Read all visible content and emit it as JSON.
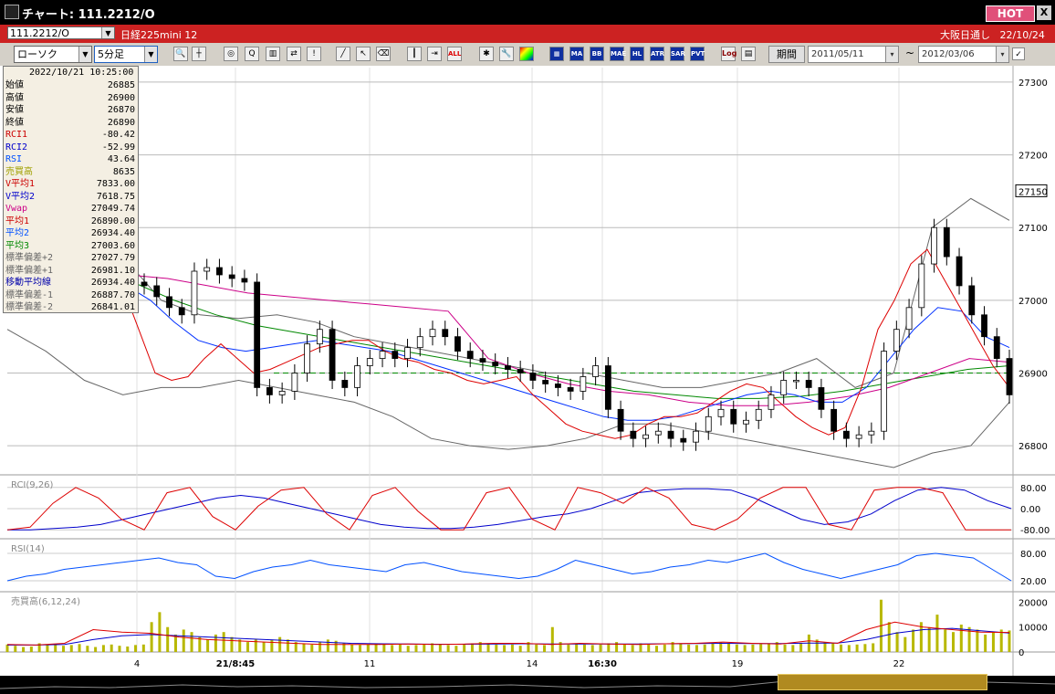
{
  "window": {
    "title": "チャート: 111.2212/O",
    "hot_label": "HOT",
    "close_label": "X"
  },
  "info_bar": {
    "symbol": "111.2212/O",
    "instrument_name": "日経225mini 12",
    "market": "大阪日通し",
    "date": "22/10/24"
  },
  "toolbar": {
    "chart_type": "ローソク",
    "period": "5分足",
    "period_button": "期間",
    "date_from": "2011/05/11",
    "date_to": "2012/03/06",
    "tilde": "~",
    "icon_labels": [
      "MA",
      "BB",
      "MAE",
      "HL",
      "ATR",
      "SAR",
      "PVT",
      "Log",
      "ALL"
    ]
  },
  "data_panel": {
    "timestamp": "2022/10/21  10:25:00",
    "rows": [
      {
        "label": "始値",
        "value": "26885",
        "color": "#000000"
      },
      {
        "label": "高値",
        "value": "26900",
        "color": "#000000"
      },
      {
        "label": "安値",
        "value": "26870",
        "color": "#000000"
      },
      {
        "label": "終値",
        "value": "26890",
        "color": "#000000"
      },
      {
        "label": "RCI1",
        "value": "-80.42",
        "color": "#cc0000"
      },
      {
        "label": "RCI2",
        "value": "-52.99",
        "color": "#0000cc"
      },
      {
        "label": "RSI",
        "value": "43.64",
        "color": "#0050ff"
      },
      {
        "label": "売買高",
        "value": "8635",
        "color": "#a0a000"
      },
      {
        "label": "V平均1",
        "value": "7833.00",
        "color": "#cc0000"
      },
      {
        "label": "V平均2",
        "value": "7618.75",
        "color": "#0000cc"
      },
      {
        "label": "Vwap",
        "value": "27049.74",
        "color": "#cc0088"
      },
      {
        "label": "平均1",
        "value": "26890.00",
        "color": "#cc0000"
      },
      {
        "label": "平均2",
        "value": "26934.40",
        "color": "#0050ff"
      },
      {
        "label": "平均3",
        "value": "27003.60",
        "color": "#008800"
      },
      {
        "label": "標準偏差+2",
        "value": "27027.79",
        "color": "#666666"
      },
      {
        "label": "標準偏差+1",
        "value": "26981.10",
        "color": "#666666"
      },
      {
        "label": "移動平均線",
        "value": "26934.40",
        "color": "#0000aa"
      },
      {
        "label": "標準偏差-1",
        "value": "26887.70",
        "color": "#666666"
      },
      {
        "label": "標準偏差-2",
        "value": "26841.01",
        "color": "#666666"
      }
    ]
  },
  "chart_data": [
    {
      "type": "candlestick",
      "price_ticks": [
        "27300",
        "27200",
        "27150",
        "27100",
        "27000",
        "26900",
        "26800"
      ],
      "price_tick_values": [
        27300,
        27200,
        27100,
        27000,
        26900,
        26800
      ],
      "current_price": "27150",
      "ylim": [
        26760,
        27320
      ],
      "x_tick_labels": [
        "4",
        "21/8:45",
        "11",
        "14",
        "16:30",
        "19",
        "22"
      ],
      "closes": [
        27020,
        27005,
        26990,
        26980,
        27040,
        27045,
        27035,
        27030,
        27025,
        26880,
        26870,
        26875,
        26900,
        26940,
        26960,
        26890,
        26880,
        26910,
        26920,
        26930,
        26920,
        26935,
        26950,
        26960,
        26950,
        26930,
        26920,
        26915,
        26910,
        26905,
        26900,
        26890,
        26885,
        26880,
        26875,
        26895,
        26910,
        26850,
        26820,
        26810,
        26815,
        26820,
        26810,
        26805,
        26820,
        26840,
        26850,
        26830,
        26835,
        26850,
        26870,
        26890,
        26890,
        26880,
        26850,
        26820,
        26810,
        26815,
        26820,
        26930,
        26960,
        26990,
        27050,
        27100,
        27060,
        27020,
        26980,
        26950,
        26920,
        26870
      ],
      "ma1": [
        27020,
        27000,
        26995,
        27010,
        27030,
        27035,
        27030,
        27020,
        26960,
        26900,
        26890,
        26895,
        26920,
        26940,
        26920,
        26900,
        26905,
        26915,
        26925,
        26935,
        26940,
        26945,
        26945,
        26930,
        26920,
        26915,
        26905,
        26900,
        26890,
        26885,
        26890,
        26895,
        26870,
        26850,
        26830,
        26820,
        26815,
        26810,
        26815,
        26830,
        26840,
        26840,
        26845,
        26860,
        26875,
        26885,
        26880,
        26860,
        26840,
        26825,
        26815,
        26825,
        26880,
        26960,
        27000,
        27050,
        27070,
        27030,
        26990,
        26950,
        26910,
        26880
      ],
      "ma2": [
        27030,
        27020,
        27010,
        27020,
        27025,
        27020,
        27000,
        26970,
        26945,
        26935,
        26930,
        26935,
        26940,
        26945,
        26940,
        26935,
        26930,
        26920,
        26910,
        26900,
        26890,
        26880,
        26870,
        26860,
        26850,
        26840,
        26835,
        26835,
        26840,
        26850,
        26860,
        26870,
        26875,
        26870,
        26860,
        26860,
        26880,
        26920,
        26960,
        26990,
        26985,
        26950,
        26935
      ],
      "ma3": [
        27070,
        27060,
        27045,
        27025,
        27000,
        26980,
        26965,
        26955,
        26945,
        26935,
        26925,
        26915,
        26905,
        26895,
        26885,
        26875,
        26870,
        26865,
        26865,
        26868,
        26875,
        26885,
        26895,
        26905,
        26910
      ],
      "vwap": [
        27050,
        27045,
        27040,
        27035,
        27030,
        27020,
        27010,
        27005,
        27000,
        26995,
        26990,
        26985,
        26920,
        26900,
        26885,
        26875,
        26870,
        26860,
        26855,
        26855,
        26860,
        26868,
        26880,
        26900,
        26920,
        26915
      ],
      "bb_upper": [
        27080,
        27090,
        27100,
        27060,
        27000,
        26980,
        26975,
        26980,
        26970,
        26950,
        26940,
        26930,
        26920,
        26910,
        26900,
        26900,
        26890,
        26880,
        26880,
        26890,
        26900,
        26920,
        26880,
        26900,
        27100,
        27140,
        27110
      ],
      "bb_lower": [
        26960,
        26930,
        26890,
        26870,
        26880,
        26880,
        26890,
        26880,
        26870,
        26860,
        26840,
        26810,
        26800,
        26795,
        26800,
        26810,
        26830,
        26830,
        26820,
        26810,
        26800,
        26790,
        26780,
        26770,
        26790,
        26800,
        26860
      ]
    },
    {
      "type": "line",
      "title": "RCI(9,26)",
      "y_tick_labels": [
        "80.00",
        "0.00",
        "-80.00"
      ],
      "ylim": [
        -100,
        100
      ],
      "series": [
        {
          "name": "RCI1",
          "values": [
            -80,
            -70,
            20,
            80,
            40,
            -40,
            -80,
            60,
            80,
            -30,
            -80,
            10,
            70,
            80,
            -20,
            -80,
            50,
            80,
            -10,
            -80,
            -80,
            60,
            80,
            -40,
            -80,
            80,
            60,
            20,
            80,
            40,
            -60,
            -80,
            -40,
            40,
            80,
            80,
            -60,
            -80,
            70,
            80,
            80,
            60,
            -80,
            -80,
            -80
          ]
        },
        {
          "name": "RCI2",
          "values": [
            -80,
            -80,
            -75,
            -70,
            -60,
            -40,
            -20,
            0,
            20,
            40,
            50,
            40,
            20,
            0,
            -20,
            -40,
            -60,
            -70,
            -75,
            -75,
            -70,
            -60,
            -45,
            -30,
            -20,
            0,
            30,
            60,
            70,
            75,
            75,
            70,
            40,
            0,
            -40,
            -60,
            -50,
            -20,
            30,
            70,
            80,
            70,
            30,
            0
          ]
        }
      ]
    },
    {
      "type": "line",
      "title": "RSI(14)",
      "y_tick_labels": [
        "80.00",
        "20.00"
      ],
      "ylim": [
        0,
        100
      ],
      "series": [
        {
          "name": "RSI",
          "values": [
            20,
            30,
            35,
            45,
            50,
            55,
            60,
            65,
            70,
            60,
            55,
            30,
            25,
            40,
            50,
            55,
            65,
            55,
            50,
            45,
            40,
            55,
            60,
            50,
            40,
            35,
            30,
            25,
            30,
            45,
            65,
            55,
            45,
            35,
            40,
            50,
            55,
            65,
            60,
            70,
            80,
            60,
            45,
            35,
            25,
            35,
            45,
            55,
            75,
            80,
            75,
            70,
            45,
            20
          ]
        }
      ]
    },
    {
      "type": "bar",
      "title": "売買高(6,12,24)",
      "y_tick_labels": [
        "20000",
        "10000",
        "0"
      ],
      "ylim": [
        0,
        22000
      ],
      "values": [
        3000,
        2500,
        2000,
        2200,
        3500,
        2800,
        3000,
        2500,
        2800,
        3200,
        2500,
        2000,
        2800,
        3000,
        2500,
        2200,
        2800,
        3000,
        12000,
        16000,
        10000,
        7000,
        9000,
        8000,
        6000,
        5000,
        7000,
        8000,
        6000,
        5000,
        4000,
        5000,
        4000,
        5000,
        6000,
        5000,
        4000,
        3500,
        3000,
        4000,
        5000,
        4500,
        3500,
        3000,
        2800,
        3000,
        3500,
        3000,
        2800,
        3000,
        2500,
        2800,
        3000,
        3500,
        3000,
        2800,
        2500,
        3000,
        3500,
        4000,
        3500,
        3000,
        2800,
        3000,
        2500,
        4000,
        3000,
        2800,
        10000,
        4000,
        3000,
        3500,
        3000,
        2800,
        3000,
        3500,
        4000,
        3000,
        2800,
        3500,
        3000,
        2500,
        3000,
        4000,
        3500,
        3000,
        2800,
        3000,
        3500,
        4000,
        3500,
        3000,
        2800,
        3000,
        3200,
        3500,
        4000,
        3000,
        2800,
        3500,
        7000,
        5000,
        4000,
        3500,
        3000,
        2800,
        3000,
        3200,
        3500,
        21000,
        12000,
        8000,
        6000,
        9000,
        12000,
        10000,
        15000,
        9000,
        8000,
        11000,
        10000,
        9000,
        7000,
        8000,
        9000,
        8635
      ],
      "ma_series": [
        {
          "name": "V平均1",
          "values": [
            3000,
            2800,
            3500,
            9000,
            8000,
            7500,
            6000,
            5000,
            4500,
            4000,
            3500,
            3000,
            3000,
            3000,
            3200,
            3000,
            3200,
            3500,
            3500,
            3000,
            3500,
            3200,
            3000,
            3300,
            3500,
            4000,
            3500,
            3200,
            4500,
            3500,
            9000,
            12000,
            10000,
            9000,
            8000,
            7833
          ]
        },
        {
          "name": "V平均2",
          "values": [
            2800,
            2800,
            3000,
            5000,
            6500,
            7000,
            6500,
            6000,
            5500,
            5000,
            4500,
            4000,
            3500,
            3300,
            3200,
            3100,
            3100,
            3200,
            3300,
            3200,
            3200,
            3200,
            3200,
            3300,
            3400,
            3500,
            3400,
            3400,
            3600,
            3600,
            5000,
            7500,
            9000,
            9500,
            8500,
            7619
          ]
        }
      ]
    }
  ],
  "colors": {
    "candle_up": "#ffffff",
    "candle_down": "#000000",
    "ma1": "#dd0000",
    "ma2": "#0030ff",
    "ma3": "#008800",
    "vwap": "#cc0088",
    "bb": "#666666",
    "rci1": "#dd0000",
    "rci2": "#0000cc",
    "rsi": "#0050ff",
    "volume": "#b8b800"
  }
}
